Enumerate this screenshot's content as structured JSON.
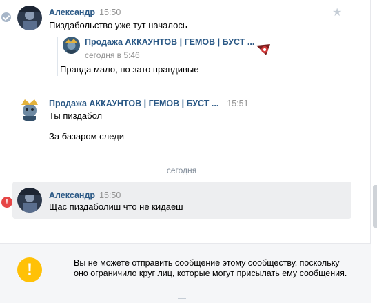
{
  "messages": [
    {
      "author": "Александр",
      "time": "15:50",
      "text": "Пиздабольство уже тут началось",
      "forward": {
        "author": "Продажа АККАУНТОВ | ГЕМОВ | БУСТ ...",
        "time": "сегодня в 5:46",
        "text": "Правда мало, но зато правдивые"
      }
    },
    {
      "author": "Продажа АККАУНТОВ | ГЕМОВ | БУСТ ...",
      "time": "15:51",
      "lines": [
        "Ты пиздабол",
        "За базаром следи"
      ]
    },
    {
      "author": "Александр",
      "time": "15:50",
      "text": "Щас пиздаболиш что не кидаеш"
    }
  ],
  "date_divider": "сегодня",
  "notice": {
    "icon": "!",
    "text": "Вы не можете отправить сообщение этому сообществу, поскольку оно ограничило круг лиц, которые могут присылать ему сообщения."
  },
  "error_icon": "!",
  "colors": {
    "link": "#2a5885",
    "warning": "#ffc107",
    "error": "#e64646",
    "unread_bg": "#edeef0"
  }
}
